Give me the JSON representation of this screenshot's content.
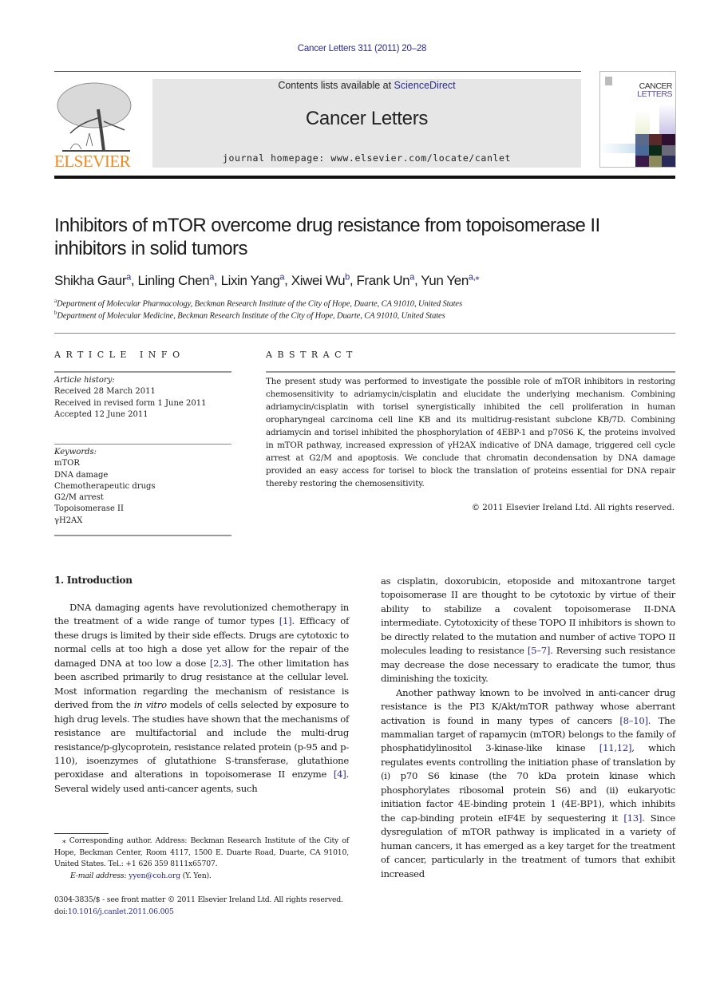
{
  "header": {
    "citation": "Cancer Letters 311 (2011) 20–28",
    "contents_prefix": "Contents lists available at ",
    "contents_link": "ScienceDirect",
    "journal_title": "Cancer Letters",
    "homepage": "journal homepage: www.elsevier.com/locate/canlet",
    "publisher_logo_text": "ELSEVIER",
    "cover_title_line1": "CANCER",
    "cover_title_line2": "LETTERS"
  },
  "colors": {
    "link": "#2a2a8e",
    "elsevier_orange": "#f08a1f",
    "banner_bg": "#e6e6e6"
  },
  "article": {
    "title_line1": "Inhibitors of mTOR overcome drug resistance from topoisomerase II",
    "title_line2": "inhibitors in solid tumors",
    "authors": [
      {
        "name": "Shikha Gaur",
        "sup": "a"
      },
      {
        "name": "Linling Chen",
        "sup": "a"
      },
      {
        "name": "Lixin Yang",
        "sup": "a"
      },
      {
        "name": "Xiwei Wu",
        "sup": "b"
      },
      {
        "name": "Frank Un",
        "sup": "a"
      },
      {
        "name": "Yun Yen",
        "sup": "a,⁎"
      }
    ],
    "affiliations": [
      {
        "sup": "a",
        "text": "Department of Molecular Pharmacology, Beckman Research Institute of the City of Hope, Duarte, CA 91010, United States"
      },
      {
        "sup": "b",
        "text": "Department of Molecular Medicine, Beckman Research Institute of the City of Hope, Duarte, CA 91010, United States"
      }
    ]
  },
  "article_info": {
    "heading": "ARTICLE INFO",
    "history_label": "Article history:",
    "history": [
      "Received 28 March 2011",
      "Received in revised form 1 June 2011",
      "Accepted 12 June 2011"
    ],
    "keywords_label": "Keywords:",
    "keywords": [
      "mTOR",
      "DNA damage",
      "Chemotherapeutic drugs",
      "G2/M arrest",
      "Topoisomerase II",
      "γH2AX"
    ]
  },
  "abstract": {
    "heading": "ABSTRACT",
    "text": "The present study was performed to investigate the possible role of mTOR inhibitors in restoring chemosensitivity to adriamycin/cisplatin and elucidate the underlying mechanism. Combining adriamycin/cisplatin with torisel synergistically inhibited the cell proliferation in human oropharyngeal carcinoma cell line KB and its multidrug-resistant subclone KB/7D. Combining adriamycin and torisel inhibited the phosphorylation of 4EBP-1 and p70S6 K, the proteins involved in mTOR pathway, increased expression of γH2AX indicative of DNA damage, triggered cell cycle arrest at G2/M and apoptosis. We conclude that chromatin decondensation by DNA damage provided an easy access for torisel to block the translation of proteins essential for DNA repair thereby restoring the chemosensitivity.",
    "copyright": "© 2011 Elsevier Ireland Ltd. All rights reserved."
  },
  "introduction": {
    "heading": "1. Introduction",
    "left_p1_a": "DNA damaging agents have revolutionized chemotherapy in the treatment of a wide range of tumor types ",
    "ref1": "[1]",
    "left_p1_b": ". Efficacy of these drugs is limited by their side effects. Drugs are cytotoxic to normal cells at too high a dose yet allow for the repair of the damaged DNA at too low a dose ",
    "ref2": "[2,3]",
    "left_p1_c": ". The other limitation has been ascribed primarily to drug resistance at the cellular level. Most information regarding the mechanism of resistance is derived from the ",
    "left_p1_italic": "in vitro",
    "left_p1_d": " models of cells selected by exposure to high drug levels. The studies have shown that the mechanisms of resistance are multifactorial and include the multi-drug resistance/p-glycoprotein, resistance related protein (p-95 and p-110), isoenzymes of glutathione S-transferase, glutathione peroxidase and alterations in topoisomerase II enzyme ",
    "ref3": "[4]",
    "left_p1_e": ". Several widely used anti-cancer agents, such",
    "right_p1_a": "as cisplatin, doxorubicin, etoposide and mitoxantrone target topoisomerase II are thought to be cytotoxic by virtue of their ability to stabilize a covalent topoisomerase II-DNA intermediate. Cytotoxicity of these TOPO II inhibitors is shown to be directly related to the mutation and number of active TOPO II molecules leading to resistance ",
    "ref4": "[5–7]",
    "right_p1_b": ". Reversing such resistance may decrease the dose necessary to eradicate the tumor, thus diminishing the toxicity.",
    "right_p2_a": "Another pathway known to be involved in anti-cancer drug resistance is the PI3 K/Akt/mTOR pathway whose aberrant activation is found in many types of cancers ",
    "ref5": "[8–10]",
    "right_p2_b": ". The mammalian target of rapamycin (mTOR) belongs to the family of phosphatidylinositol 3-kinase-like kinase ",
    "ref6": "[11,12]",
    "right_p2_c": ", which regulates events controlling the initiation phase of translation by (i) p70 S6 kinase (the 70 kDa protein kinase which phosphorylates ribosomal protein S6) and (ii) eukaryotic initiation factor 4E-binding protein 1 (4E-BP1), which inhibits the cap-binding protein eIF4E by sequestering it ",
    "ref7": "[13]",
    "right_p2_d": ". Since dysregulation of mTOR pathway is implicated in a variety of human cancers, it has emerged as a key target for the treatment of cancer, particularly in the treatment of tumors that exhibit increased"
  },
  "footnote": {
    "corresponding": "⁎ Corresponding author. Address: Beckman Research Institute of the City of Hope, Beckman Center, Room 4117, 1500 E. Duarte Road, Duarte, CA 91010, United States. Tel.: +1 626 359 8111x65707.",
    "email_label": "E-mail address: ",
    "email": "yyen@coh.org",
    "email_suffix": " (Y. Yen).",
    "front_matter": "0304-3835/$ - see front matter © 2011 Elsevier Ireland Ltd. All rights reserved.",
    "doi_label": "doi:",
    "doi": "10.1016/j.canlet.2011.06.005"
  }
}
